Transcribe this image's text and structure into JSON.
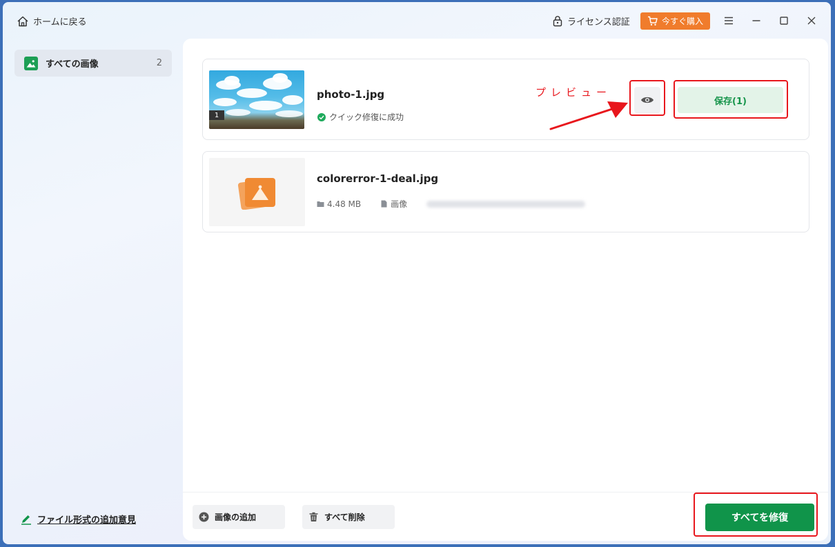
{
  "titlebar": {
    "home_label": "ホームに戻る",
    "license_label": "ライセンス認証",
    "buy_label": "今すぐ購入"
  },
  "sidebar": {
    "items": [
      {
        "label": "すべての画像",
        "count": "2"
      }
    ],
    "add_format_label": "ファイル形式の追加意見"
  },
  "files": [
    {
      "name": "photo-1.jpg",
      "badge": "1",
      "status": "クイック修復に成功",
      "save_label": "保存(1)"
    },
    {
      "name": "colorerror-1-deal.jpg",
      "size": "4.48 MB",
      "type": "画像"
    }
  ],
  "annotation": {
    "preview_label": "プレビュー"
  },
  "footer": {
    "add_image_label": "画像の追加",
    "delete_all_label": "すべて削除",
    "repair_all_label": "すべてを修復"
  },
  "colors": {
    "accent_green": "#10944a",
    "buy_orange": "#f07c2c",
    "annotation_red": "#e8161c"
  }
}
